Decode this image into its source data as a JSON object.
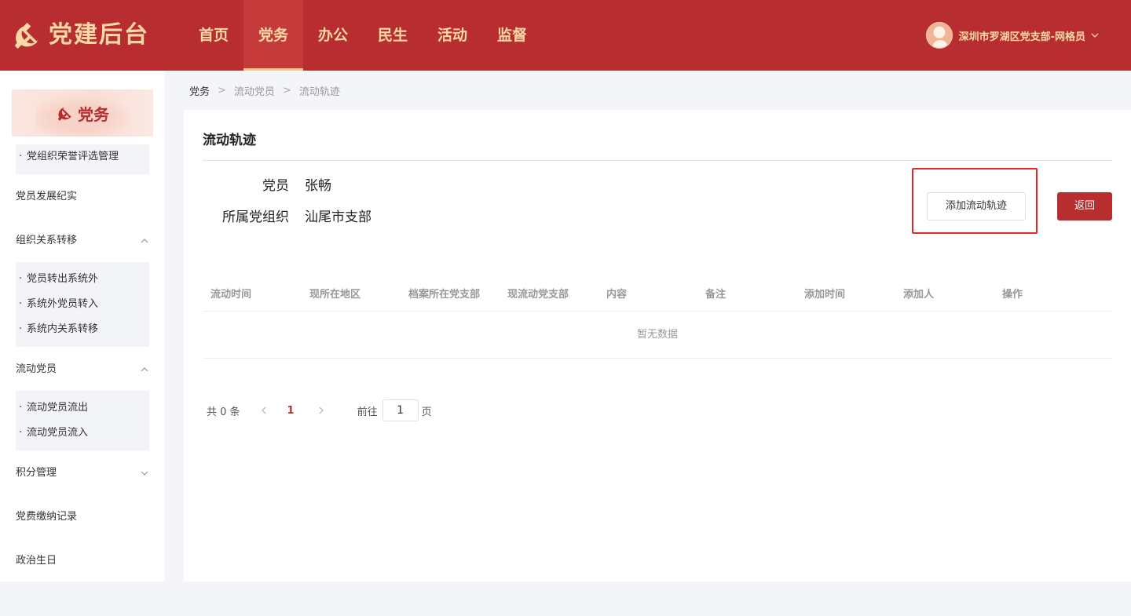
{
  "app": {
    "title": "党建后台"
  },
  "nav": [
    {
      "label": "首页",
      "active": false
    },
    {
      "label": "党务",
      "active": true
    },
    {
      "label": "办公",
      "active": false
    },
    {
      "label": "民生",
      "active": false
    },
    {
      "label": "活动",
      "active": false
    },
    {
      "label": "监督",
      "active": false
    }
  ],
  "user": {
    "name": "深圳市罗湖区党支部-网格员"
  },
  "sidebar": {
    "banner": "党务",
    "group1": [
      "党组织荣誉评选管理"
    ],
    "menu": {
      "develop": "党员发展纪实",
      "transfer": "组织关系转移",
      "mobile": "流动党员",
      "points": "积分管理",
      "fees": "党费缴纳记录",
      "birthday": "政治生日"
    },
    "transfer_items": [
      "党员转出系统外",
      "系统外党员转入",
      "系统内关系转移"
    ],
    "mobile_items": [
      "流动党员流出",
      "流动党员流入"
    ]
  },
  "breadcrumb": [
    "党务",
    "流动党员",
    "流动轨迹"
  ],
  "card": {
    "title": "流动轨迹",
    "member_label": "党员",
    "member_value": "张畅",
    "org_label": "所属党组织",
    "org_value": "汕尾市支部",
    "add_button": "添加流动轨迹",
    "back_button": "返回"
  },
  "table": {
    "columns": [
      "流动时间",
      "现所在地区",
      "档案所在党支部",
      "现流动党支部",
      "内容",
      "备注",
      "添加时间",
      "添加人",
      "操作"
    ],
    "empty_text": "暂无数据"
  },
  "pager": {
    "total_text": "共 0 条",
    "current_page": "1",
    "goto_label": "前往",
    "goto_value": "1",
    "page_suffix": "页"
  },
  "colors": {
    "brand": "#b82d30",
    "gold": "#fbd9a7",
    "highlight": "#e8262b"
  }
}
